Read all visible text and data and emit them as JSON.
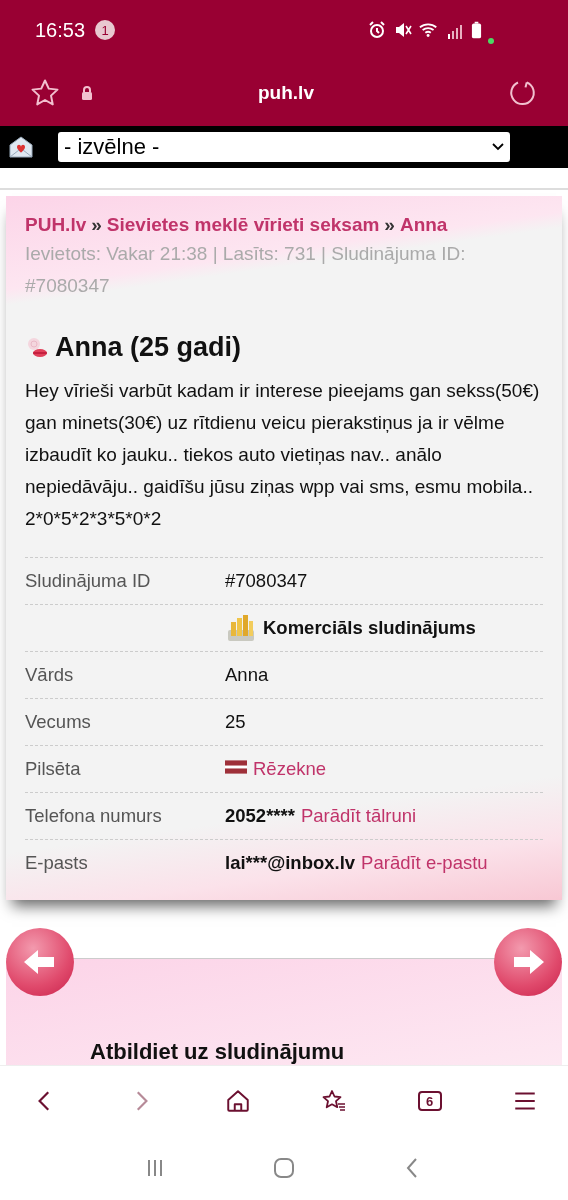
{
  "status_bar": {
    "time": "16:53",
    "notification_count": "1"
  },
  "browser": {
    "url": "puh.lv",
    "tab_count": "6"
  },
  "menu_select": {
    "value": "- izvēlne -"
  },
  "breadcrumb": [
    {
      "kind": "link",
      "text": "PUH.lv"
    },
    {
      "kind": "separator",
      "text": "»"
    },
    {
      "kind": "link",
      "text": "Sievietes meklē vīrieti seksam"
    },
    {
      "kind": "separator",
      "text": "»"
    },
    {
      "kind": "link",
      "text": "Anna"
    }
  ],
  "meta": "Ievietots: Vakar 21:38 | Lasīts: 731 | Sludinājuma ID: #7080347",
  "title": "Anna (25 gadi)",
  "description": "Hey vīrieši varbūt kadam ir interese pieejams gan sekss(50€) gan minets(30€) uz rītdienu veicu pierakstiņus ja ir vēlme izbaudīt ko jauku.. tiekos auto vietiņas nav.. anālo nepiedāvāju.. gaidīšu jūsu ziņas wpp vai sms, esmu mobila.. 2*0*5*2*3*5*0*2",
  "details": [
    {
      "kind": "text",
      "label": "Sludinājuma ID",
      "value": "#7080347"
    },
    {
      "kind": "commercial",
      "value": "Komerciāls sludinājums"
    },
    {
      "kind": "text",
      "label": "Vārds",
      "value": "Anna"
    },
    {
      "kind": "text",
      "label": "Vecums",
      "value": "25"
    },
    {
      "kind": "city",
      "label": "Pilsēta",
      "value": "Rēzekne"
    },
    {
      "kind": "contact",
      "label": "Telefona numurs",
      "value": "2052****",
      "link": "Parādīt tālruni"
    },
    {
      "kind": "contact",
      "label": "E-pasts",
      "value": "lai***@inbox.lv",
      "link": "Parādīt e-pastu"
    }
  ],
  "reply_heading": "Atbildiet uz sludinājumu"
}
